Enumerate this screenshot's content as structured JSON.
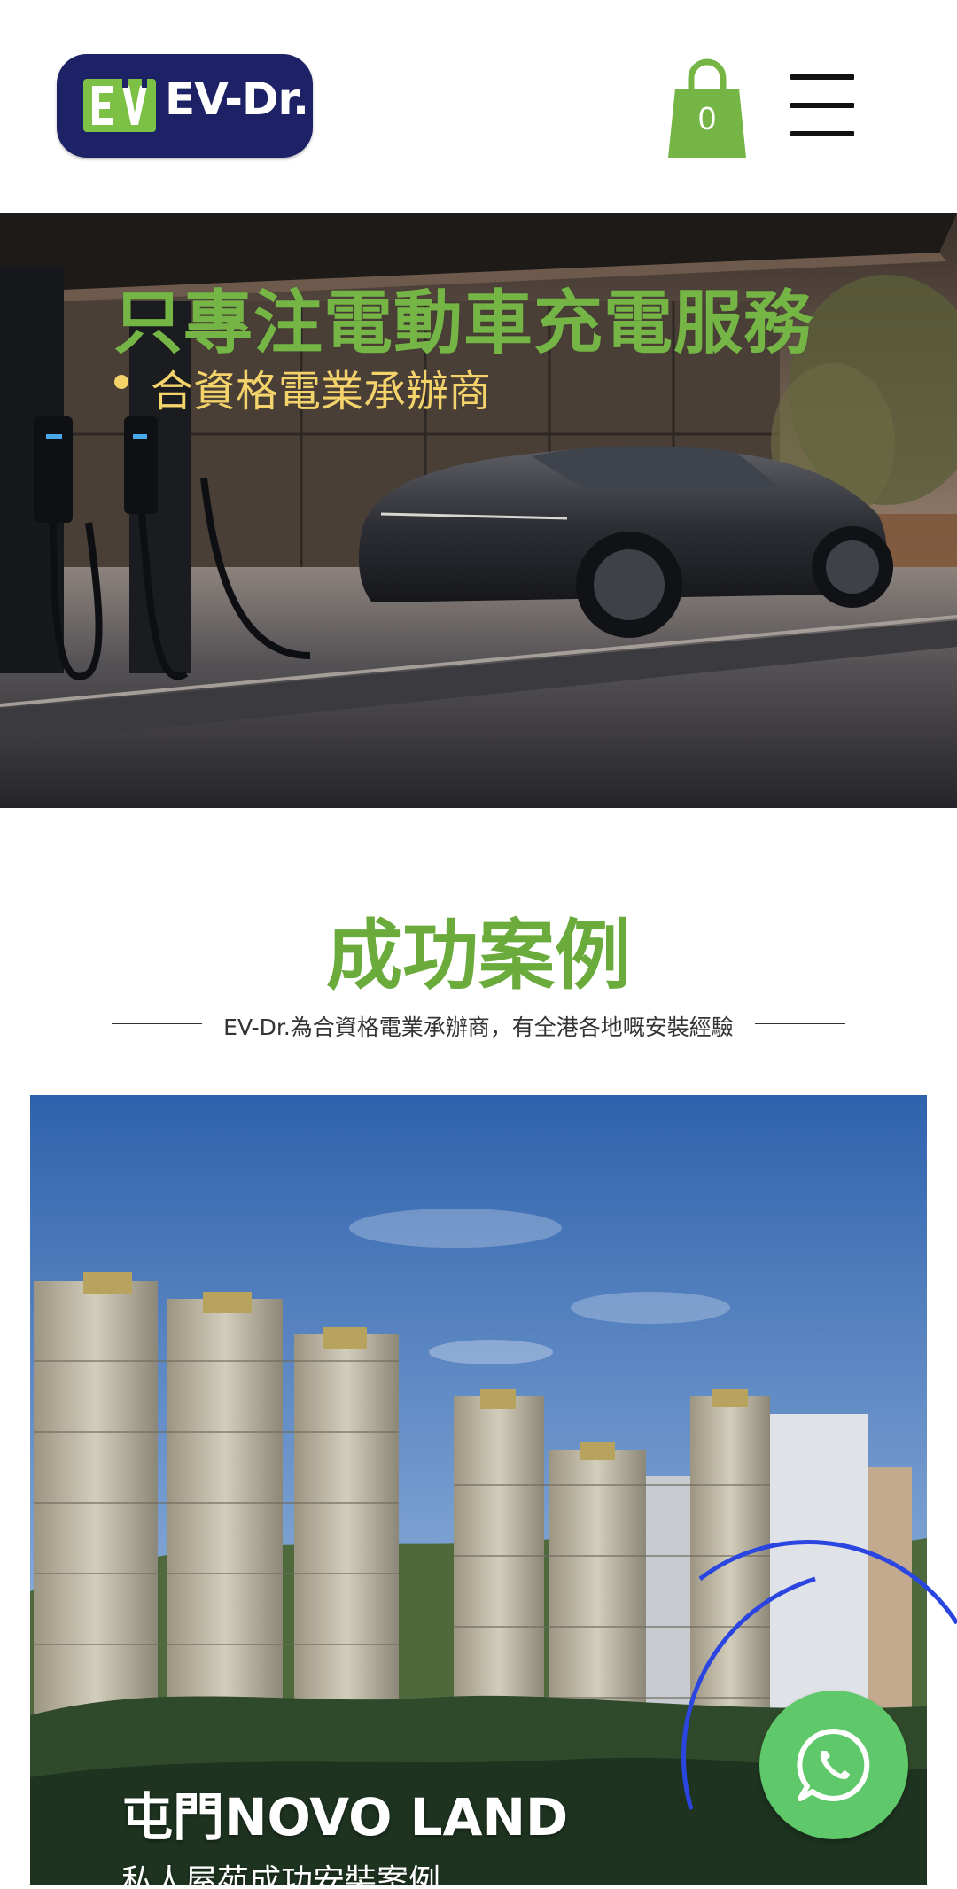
{
  "header": {
    "logo_text": "EV-Dr.",
    "logo_mark_text": "EV",
    "cart_count": "0",
    "cart_icon": "shopping-bag-icon",
    "menu_icon": "hamburger-menu-icon"
  },
  "hero": {
    "title": "只專注電動車充電服務",
    "subtitle": "合資格電業承辦商"
  },
  "section": {
    "title": "成功案例",
    "subtitle": "EV-Dr.為合資格電業承辦商，有全港各地嘅安裝經驗"
  },
  "case": {
    "title": "屯門NOVO LAND",
    "subtitle": "私人屋苑成功安裝案例"
  },
  "whatsapp": {
    "icon": "whatsapp-icon"
  },
  "colors": {
    "brand_green": "#6aab3c",
    "logo_navy": "#1d2266",
    "hero_subtitle": "#f4d36a",
    "whatsapp_green": "#5fc86a",
    "accent_ring": "#2b46e0"
  }
}
